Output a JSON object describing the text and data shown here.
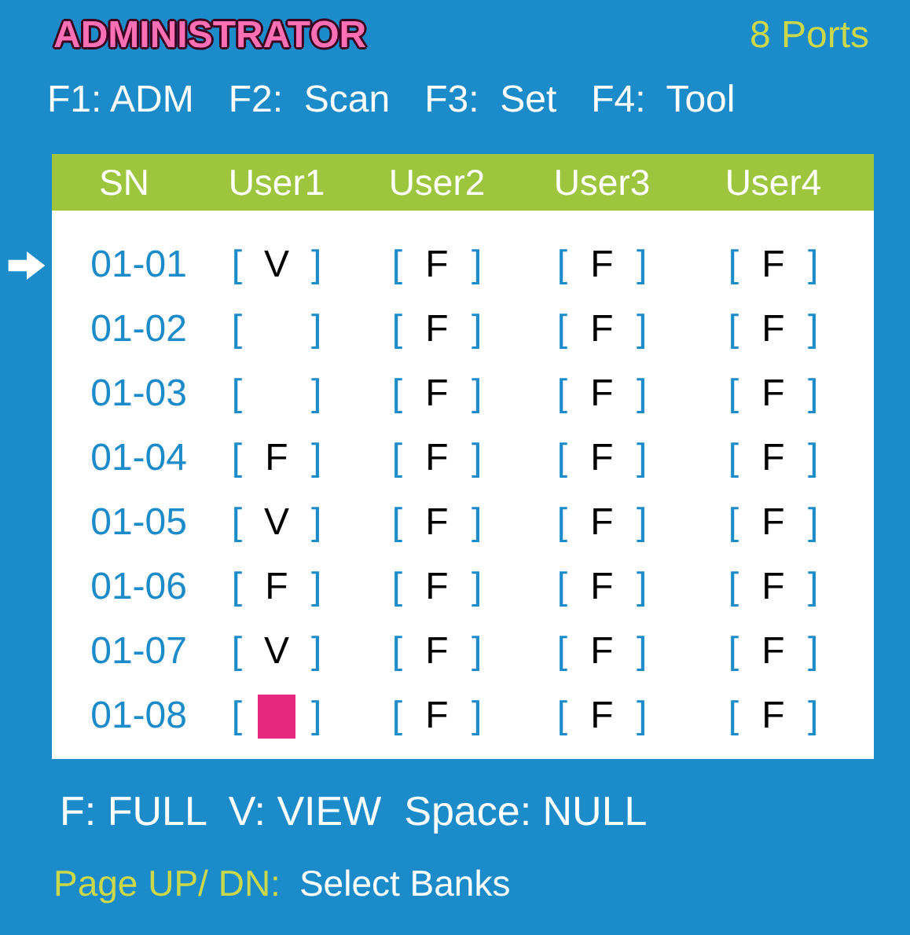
{
  "title": "ADMINISTRATOR",
  "ports": "8 Ports",
  "function_keys": [
    "F1: ADM",
    "F2:  Scan",
    "F3:  Set",
    "F4:  Tool"
  ],
  "table": {
    "columns": [
      "SN",
      "User1",
      "User2",
      "User3",
      "User4"
    ],
    "rows": [
      {
        "selected": true,
        "cells": [
          {
            "kind": "sn",
            "value": "01-01"
          },
          {
            "kind": "access",
            "left": "[",
            "value": "V",
            "right": "]",
            "selected": false
          },
          {
            "kind": "access",
            "left": "[",
            "value": "F",
            "right": "]",
            "selected": false
          },
          {
            "kind": "access",
            "left": "[",
            "value": "F",
            "right": "]",
            "selected": false
          },
          {
            "kind": "access",
            "left": "[",
            "value": "F",
            "right": "]",
            "selected": false
          }
        ]
      },
      {
        "selected": false,
        "cells": [
          {
            "kind": "sn",
            "value": "01-02"
          },
          {
            "kind": "access",
            "left": "[",
            "right": "]",
            "selected": false
          },
          {
            "kind": "access",
            "left": "[",
            "value": "F",
            "right": "]",
            "selected": false
          },
          {
            "kind": "access",
            "left": "[",
            "value": "F",
            "right": "]",
            "selected": false
          },
          {
            "kind": "access",
            "left": "[",
            "value": "F",
            "right": "]",
            "selected": false
          }
        ]
      },
      {
        "selected": false,
        "cells": [
          {
            "kind": "sn",
            "value": "01-03"
          },
          {
            "kind": "access",
            "left": "[",
            "right": "]",
            "selected": false
          },
          {
            "kind": "access",
            "left": "[",
            "value": "F",
            "right": "]",
            "selected": false
          },
          {
            "kind": "access",
            "left": "[",
            "value": "F",
            "right": "]",
            "selected": false
          },
          {
            "kind": "access",
            "left": "[",
            "value": "F",
            "right": "]",
            "selected": false
          }
        ]
      },
      {
        "selected": false,
        "cells": [
          {
            "kind": "sn",
            "value": "01-04"
          },
          {
            "kind": "access",
            "left": "[",
            "value": "F",
            "right": "]",
            "selected": false
          },
          {
            "kind": "access",
            "left": "[",
            "value": "F",
            "right": "]",
            "selected": false
          },
          {
            "kind": "access",
            "left": "[",
            "value": "F",
            "right": "]",
            "selected": false
          },
          {
            "kind": "access",
            "left": "[",
            "value": "F",
            "right": "]",
            "selected": false
          }
        ]
      },
      {
        "selected": false,
        "cells": [
          {
            "kind": "sn",
            "value": "01-05"
          },
          {
            "kind": "access",
            "left": "[",
            "value": "V",
            "right": "]",
            "selected": false
          },
          {
            "kind": "access",
            "left": "[",
            "value": "F",
            "right": "]",
            "selected": false
          },
          {
            "kind": "access",
            "left": "[",
            "value": "F",
            "right": "]",
            "selected": false
          },
          {
            "kind": "access",
            "left": "[",
            "value": "F",
            "right": "]",
            "selected": false
          }
        ]
      },
      {
        "selected": false,
        "cells": [
          {
            "kind": "sn",
            "value": "01-06"
          },
          {
            "kind": "access",
            "left": "[",
            "value": "F",
            "right": "]",
            "selected": false
          },
          {
            "kind": "access",
            "left": "[",
            "value": "F",
            "right": "]",
            "selected": false
          },
          {
            "kind": "access",
            "left": "[",
            "value": "F",
            "right": "]",
            "selected": false
          },
          {
            "kind": "access",
            "left": "[",
            "value": "F",
            "right": "]",
            "selected": false
          }
        ]
      },
      {
        "selected": false,
        "cells": [
          {
            "kind": "sn",
            "value": "01-07"
          },
          {
            "kind": "access",
            "left": "[",
            "value": "V",
            "right": "]",
            "selected": false
          },
          {
            "kind": "access",
            "left": "[",
            "value": "F",
            "right": "]",
            "selected": false
          },
          {
            "kind": "access",
            "left": "[",
            "value": "F",
            "right": "]",
            "selected": false
          },
          {
            "kind": "access",
            "left": "[",
            "value": "F",
            "right": "]",
            "selected": false
          }
        ]
      },
      {
        "selected": false,
        "cells": [
          {
            "kind": "sn",
            "value": "01-08"
          },
          {
            "kind": "access",
            "left": "[",
            "right": "]",
            "selected": true
          },
          {
            "kind": "access",
            "left": "[",
            "value": "F",
            "right": "]",
            "selected": false
          },
          {
            "kind": "access",
            "left": "[",
            "value": "F",
            "right": "]",
            "selected": false
          },
          {
            "kind": "access",
            "left": "[",
            "value": "F",
            "right": "]",
            "selected": false
          }
        ]
      }
    ]
  },
  "legend": "F: FULL  V: VIEW  Space: NULL",
  "footer": {
    "keys": "Page UP/ DN:",
    "action": "Select Banks"
  }
}
